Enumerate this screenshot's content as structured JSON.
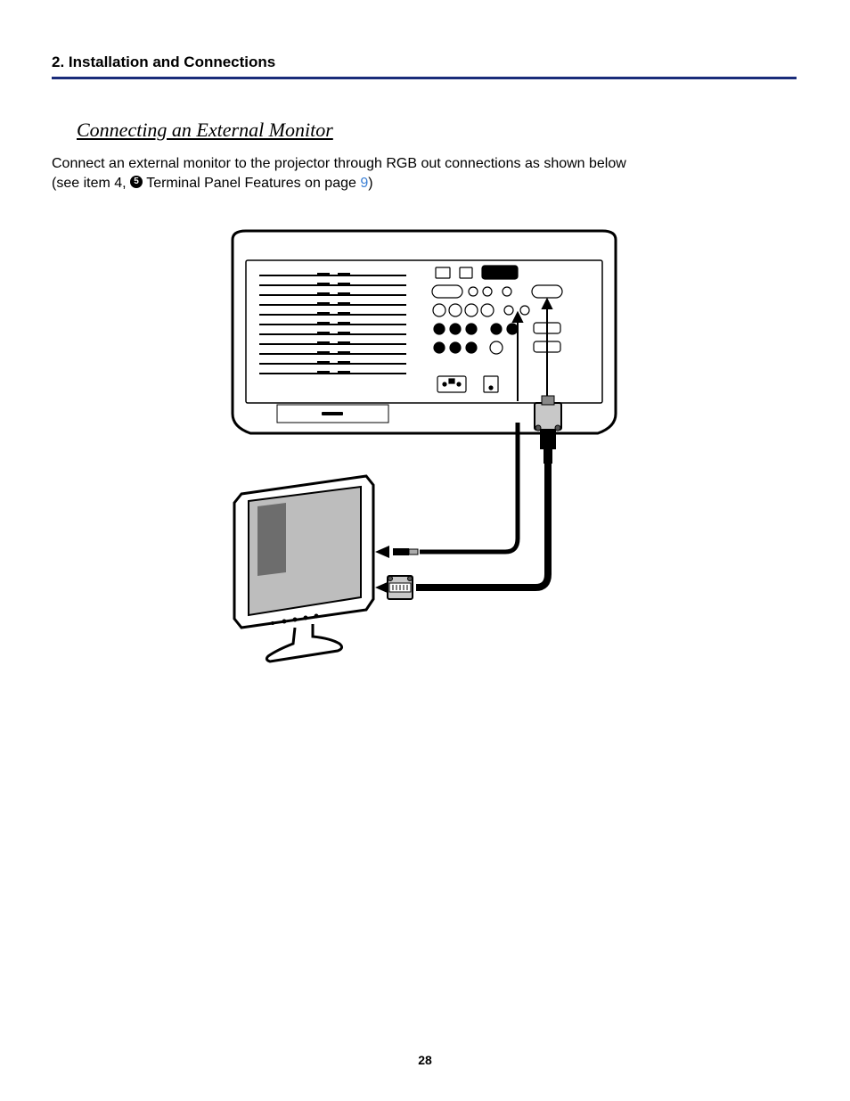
{
  "header": {
    "section_label": "2. Installation and Connections"
  },
  "subheading": "Connecting an External Monitor",
  "para": {
    "line1": "Connect an external monitor to the projector through RGB out connections as shown below",
    "line2a": "(see item 4, ",
    "circle": "5",
    "line2b": " Terminal Panel Features on page ",
    "link": "9",
    "line2c": ")"
  },
  "page_number": "28",
  "diagram": {
    "description": "Projector rear panel with RGB-out cable connected to an external LCD monitor",
    "elements": {
      "projector": "projector-rear-panel",
      "monitor": "external-lcd-monitor",
      "cable_vga": "vga-cable",
      "cable_audio": "audio-cable"
    }
  }
}
